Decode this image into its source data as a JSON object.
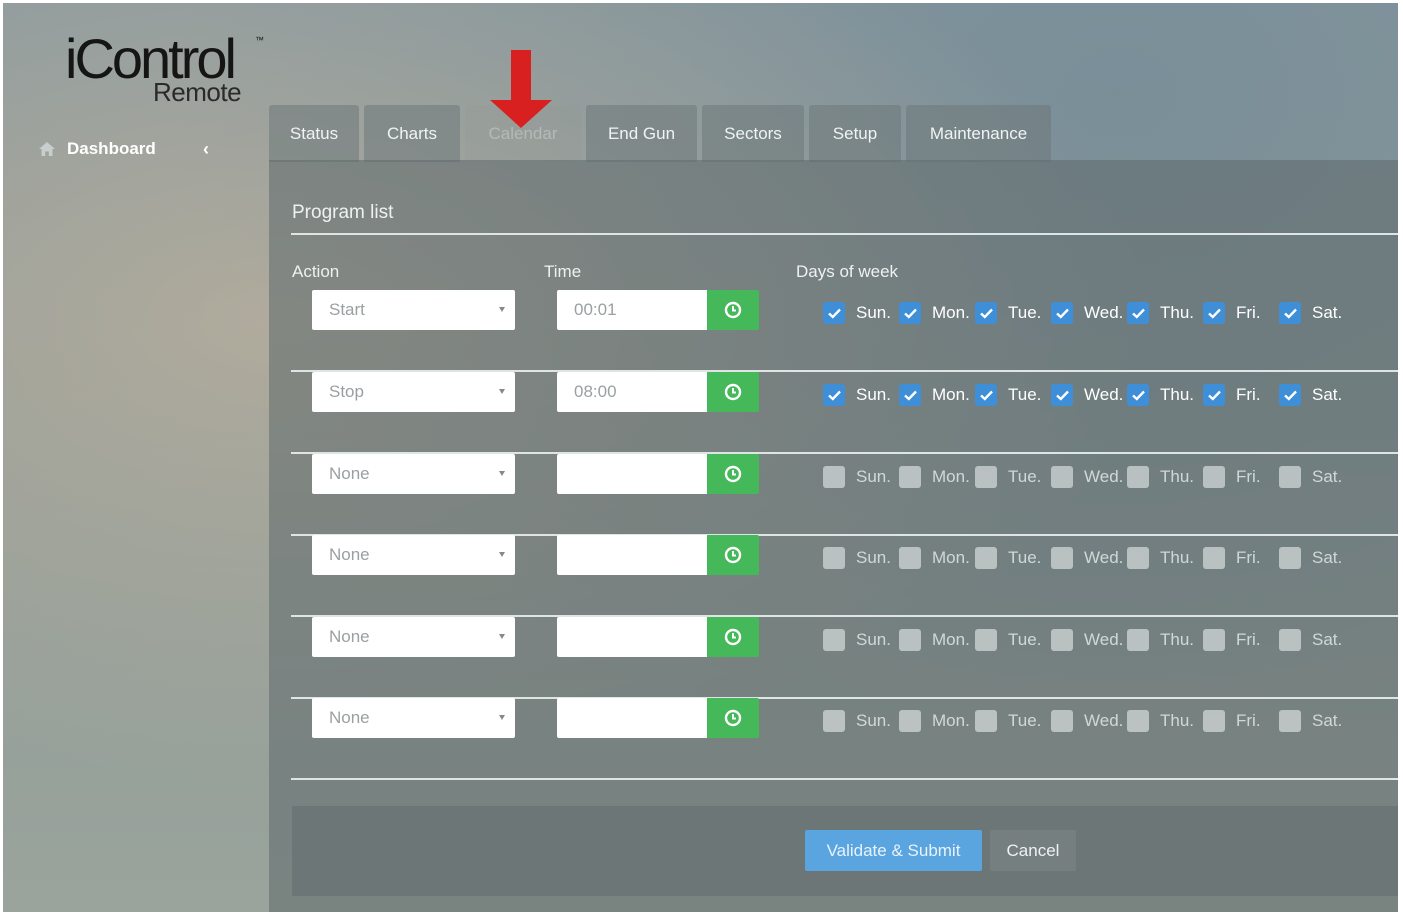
{
  "app": {
    "logo_main": "iControl",
    "logo_tm": "™",
    "logo_sub": "Remote"
  },
  "sidebar": {
    "items": [
      {
        "label": "Dashboard",
        "icon": "home-icon",
        "chevron": "‹"
      }
    ]
  },
  "tabs": [
    {
      "label": "Status",
      "active": false
    },
    {
      "label": "Charts",
      "active": false
    },
    {
      "label": "Calendar",
      "active": true
    },
    {
      "label": "End Gun",
      "active": false
    },
    {
      "label": "Sectors",
      "active": false
    },
    {
      "label": "Setup",
      "active": false
    },
    {
      "label": "Maintenance",
      "active": false
    }
  ],
  "panel": {
    "title": "Program list",
    "columns": {
      "action": "Action",
      "time": "Time",
      "days": "Days of week"
    }
  },
  "days": [
    "Sun.",
    "Mon.",
    "Tue.",
    "Wed.",
    "Thu.",
    "Fri.",
    "Sat."
  ],
  "programs": [
    {
      "action": "Start",
      "time": "00:01",
      "days": [
        true,
        true,
        true,
        true,
        true,
        true,
        true
      ]
    },
    {
      "action": "Stop",
      "time": "08:00",
      "days": [
        true,
        true,
        true,
        true,
        true,
        true,
        true
      ]
    },
    {
      "action": "None",
      "time": "",
      "days": [
        false,
        false,
        false,
        false,
        false,
        false,
        false
      ]
    },
    {
      "action": "None",
      "time": "",
      "days": [
        false,
        false,
        false,
        false,
        false,
        false,
        false
      ]
    },
    {
      "action": "None",
      "time": "",
      "days": [
        false,
        false,
        false,
        false,
        false,
        false,
        false
      ]
    },
    {
      "action": "None",
      "time": "",
      "days": [
        false,
        false,
        false,
        false,
        false,
        false,
        false
      ]
    }
  ],
  "buttons": {
    "validate": "Validate & Submit",
    "cancel": "Cancel"
  },
  "colors": {
    "accent_green": "#45b85a",
    "checkbox_blue": "#3f8fd8",
    "submit_blue": "#5aa5df",
    "annotation_red": "#d7201f"
  },
  "annotation": {
    "icon": "red-down-arrow-icon",
    "points_to": "Calendar"
  }
}
